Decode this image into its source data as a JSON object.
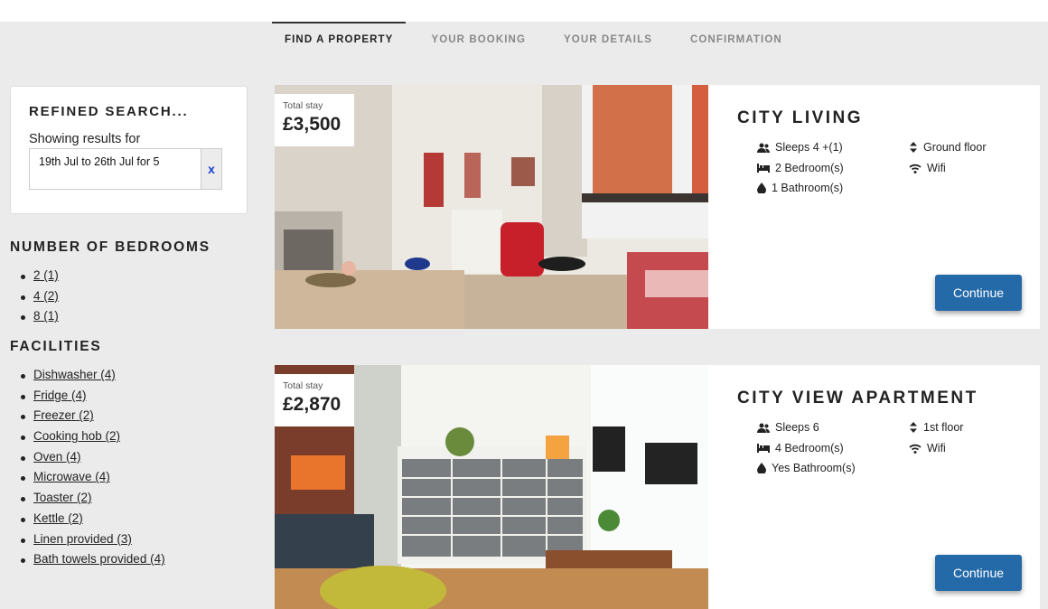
{
  "tabs": [
    "FIND A PROPERTY",
    "YOUR BOOKING",
    "YOUR DETAILS",
    "CONFIRMATION"
  ],
  "search": {
    "title": "REFINED SEARCH...",
    "subtitle": "Showing results for",
    "value": "19th Jul to 26th Jul for 5",
    "clear": "x"
  },
  "bedrooms": {
    "title": "NUMBER OF BEDROOMS",
    "items": [
      "2 (1)",
      "4 (2)",
      "8 (1)"
    ]
  },
  "facilities": {
    "title": "FACILITIES",
    "items": [
      "Dishwasher (4)",
      "Fridge (4)",
      "Freezer (2)",
      "Cooking hob (2)",
      "Oven (4)",
      "Microwave (4)",
      "Toaster (2)",
      "Kettle (2)",
      "Linen provided (3)",
      "Bath towels provided (4)"
    ]
  },
  "properties": [
    {
      "price_label": "Total stay",
      "price": "£3,500",
      "title": "CITY LIVING",
      "sleeps": "Sleeps 4 +(1)",
      "bedrooms": "2 Bedroom(s)",
      "bathrooms": "1 Bathroom(s)",
      "floor": "Ground floor",
      "wifi": "Wifi",
      "button": "Continue"
    },
    {
      "price_label": "Total stay",
      "price": "£2,870",
      "title": "CITY VIEW APARTMENT",
      "sleeps": "Sleeps 6",
      "bedrooms": "4 Bedroom(s)",
      "bathrooms": "Yes Bathroom(s)",
      "floor": "1st floor",
      "wifi": "Wifi",
      "button": "Continue"
    }
  ],
  "colors": {
    "accent": "#2469a8",
    "clear": "#1a3fd6",
    "background": "#ebebeb"
  }
}
